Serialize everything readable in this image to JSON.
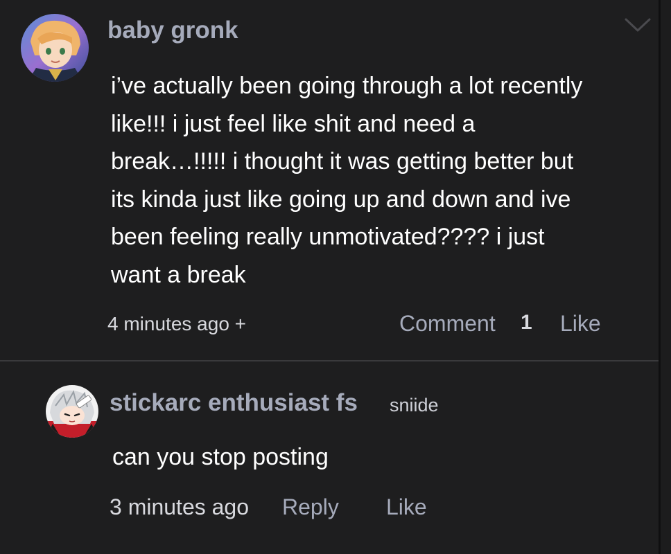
{
  "post": {
    "username": "baby gronk",
    "body_lines": [
      "i’ve actually been going through a lot recently",
      "like!!! i just feel like shit and need a",
      "break…!!!!! i thought it was getting better but",
      "its kinda just like going up and down and ive",
      "been feeling really unmotivated???? i just",
      "want a break"
    ],
    "timestamp": "4 minutes ago +",
    "comment_label": "Comment",
    "like_count": "1",
    "like_label": "Like",
    "collapse_icon": "chevron-down-icon"
  },
  "reply": {
    "username": "stickarc enthusiast fs",
    "tag": "sniide",
    "body": "can you stop posting",
    "timestamp": "3 minutes ago",
    "reply_label": "Reply",
    "like_label": "Like"
  },
  "colors": {
    "background": "#1e1e1f",
    "username": "#a6abbb",
    "action": "#a6abbb",
    "body_text": "#ffffff",
    "meta_text": "#d8d9de",
    "divider": "#3a3a3c"
  }
}
